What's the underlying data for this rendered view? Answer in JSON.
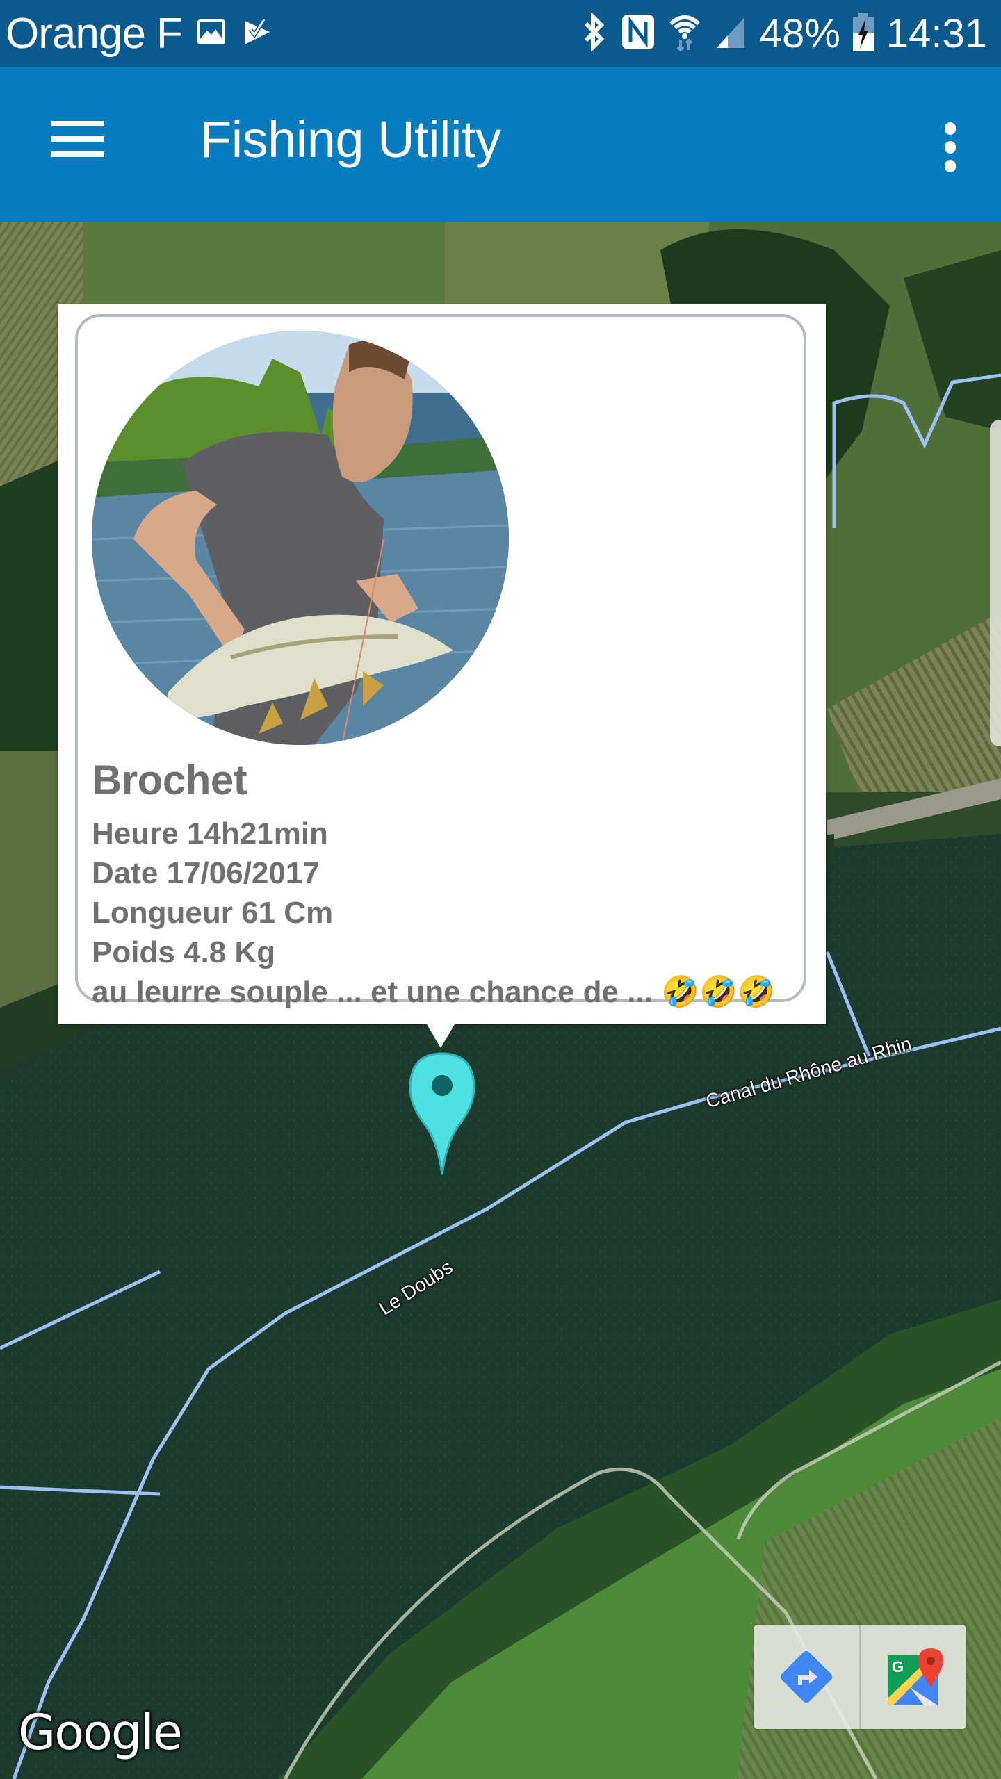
{
  "status_bar": {
    "carrier": "Orange F",
    "notification_icons": [
      "image-icon",
      "task-check-icon"
    ],
    "system_icons": [
      "bluetooth-icon",
      "nfc-icon",
      "wifi-icon",
      "cellular-signal-icon"
    ],
    "battery_percent": "48%",
    "battery_charging": true,
    "time": "14:31"
  },
  "app_bar": {
    "title": "Fishing Utility",
    "menu_icon": "hamburger-menu-icon",
    "overflow_icon": "more-vert-icon",
    "color": "#067cbe"
  },
  "catch": {
    "species": "Brochet",
    "time": "Heure 14h21min",
    "date": "Date 17/06/2017",
    "length": "Longueur 61 Cm",
    "weight": "Poids 4.8 Kg",
    "comment": "au leurre souple ... et une chance de ...",
    "emoji": "🤣🤣🤣"
  },
  "map": {
    "labels": {
      "canal": "Canal du Rhône au Rhin",
      "river": "Le Doubs"
    },
    "marker_color": "#4fe0e2",
    "attribution": "Google",
    "toolbar": {
      "directions_icon": "directions-icon",
      "open_maps_icon": "google-maps-icon"
    }
  }
}
